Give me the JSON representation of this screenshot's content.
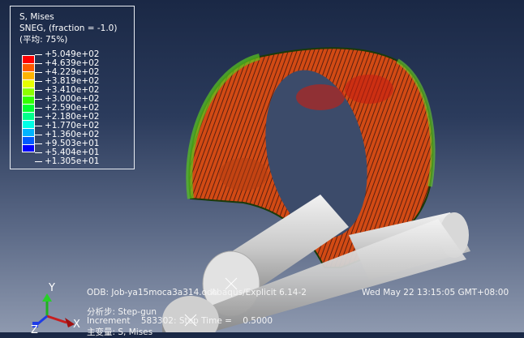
{
  "legend": {
    "title": "S, Mises",
    "subtitle": "SNEG, (fraction = -1.0)",
    "averaging": "(平均: 75%)",
    "levels": [
      "+5.049e+02",
      "+4.639e+02",
      "+4.229e+02",
      "+3.819e+02",
      "+3.410e+02",
      "+3.000e+02",
      "+2.590e+02",
      "+2.180e+02",
      "+1.770e+02",
      "+1.360e+02",
      "+9.503e+01",
      "+5.404e+01",
      "+1.305e+01"
    ],
    "colors": [
      "#ff0000",
      "#ff5a00",
      "#ffb400",
      "#e6ff00",
      "#8cff00",
      "#32ff00",
      "#00ff32",
      "#00ff8c",
      "#00ffe6",
      "#00b4ff",
      "#005aff",
      "#0000ff"
    ]
  },
  "info": {
    "odb": "ODB: Job-ya15moca3a314.odb",
    "solver": "Abaqus/Explicit 6.14-2",
    "date": "Wed May 22 13:15:05 GMT+08:00",
    "step": "分析步: Step-gun",
    "increment": "Increment    583302: Step Time =    0.5000",
    "primary": "主变量: S, Mises"
  },
  "triad": {
    "y": "Y",
    "x": "X",
    "z": "Z"
  }
}
